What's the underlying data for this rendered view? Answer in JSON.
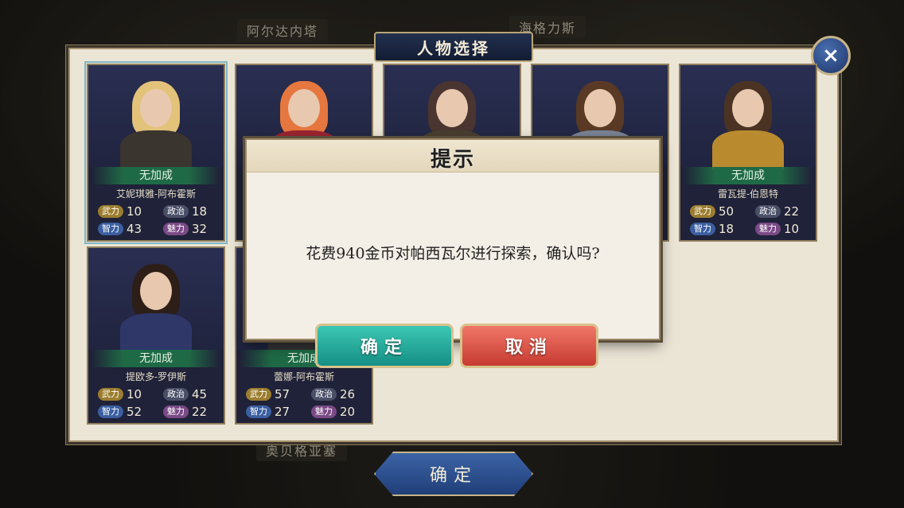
{
  "map": {
    "labels": [
      "阿尔达内塔",
      "海格力斯",
      "奥贝格亚塞"
    ]
  },
  "panel": {
    "title": "人物选择"
  },
  "stat_labels": {
    "wu": "武力",
    "zz": "政治",
    "zl": "智力",
    "ml": "魅力"
  },
  "cards": [
    {
      "name": "艾妮琪雅-阿布霍斯",
      "bonus": "无加成",
      "wu": "10",
      "zz": "18",
      "zl": "43",
      "ml": "32",
      "hair": "#e3c27a",
      "body": "#3b3530"
    },
    {
      "name": "",
      "bonus": "",
      "wu": "",
      "zz": "",
      "zl": "",
      "ml": "",
      "hair": "#e5773f",
      "body": "#9b2430"
    },
    {
      "name": "",
      "bonus": "",
      "wu": "",
      "zz": "",
      "zl": "",
      "ml": "",
      "hair": "#4a3530",
      "body": "#4a3e30"
    },
    {
      "name": "",
      "bonus": "",
      "wu": "",
      "zz": "",
      "zl": "",
      "ml": "",
      "hair": "#5a3a25",
      "body": "#7a8396"
    },
    {
      "name": "雷瓦提-伯恩特",
      "bonus": "无加成",
      "wu": "50",
      "zz": "22",
      "zl": "18",
      "ml": "10",
      "hair": "#4a3322",
      "body": "#b98a2e"
    },
    {
      "name": "提欧多-罗伊斯",
      "bonus": "无加成",
      "wu": "10",
      "zz": "45",
      "zl": "52",
      "ml": "22",
      "hair": "#2d1e18",
      "body": "#2e3768"
    },
    {
      "name": "蕾娜-阿布霍斯",
      "bonus": "无加成",
      "wu": "57",
      "zz": "26",
      "zl": "27",
      "ml": "20",
      "hair": "#3a2a20",
      "body": "#333"
    }
  ],
  "dialog": {
    "title": "提示",
    "message": "花费940金币对帕西瓦尔进行探索，确认吗?",
    "confirm": "确定",
    "cancel": "取消"
  },
  "bottom_button": "确定",
  "close_icon": "×"
}
